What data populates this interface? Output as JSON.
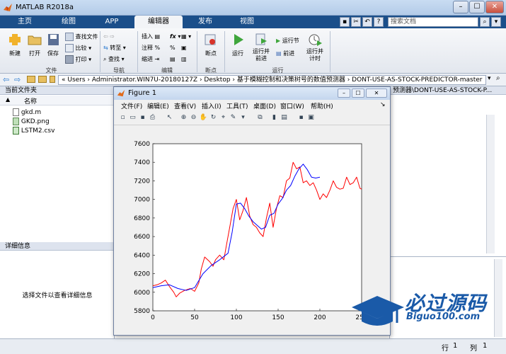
{
  "window": {
    "title": "MATLAB R2018a",
    "controls": [
      "–",
      "☐",
      "✕"
    ]
  },
  "ribbon_tabs": [
    "主页",
    "绘图",
    "APP",
    "编辑器",
    "发布",
    "视图"
  ],
  "active_tab": "编辑器",
  "search": {
    "placeholder": "搜索文档"
  },
  "ribbon": {
    "groups": {
      "file": "文件",
      "navigate": "导航",
      "edit": "编辑",
      "breakpoints": "断点",
      "run": "运行"
    },
    "file": {
      "new": "新建",
      "open": "打开",
      "save": "保存",
      "find_files": "查找文件",
      "compare": "比较",
      "print": "打印"
    },
    "navigate": {
      "goto": "转至",
      "find": "查找"
    },
    "edit": {
      "insert": "插入",
      "comment": "注释",
      "indent": "缩进"
    },
    "breakpoints": {
      "breakpoints": "断点"
    },
    "run": {
      "run": "运行",
      "run_advance": "运行并\n前进",
      "run_section": "运行节",
      "advance": "前进",
      "run_time": "运行并\n计时"
    }
  },
  "address": {
    "path": "«  Users  ›  Administrator.WIN7U-20180127Z  ›  Desktop  ›  基于模糊控制和决策树号的数值预测器  ›  DONT-USE-AS-STOCK-PREDICTOR-master"
  },
  "file_panel": {
    "header": "当前文件夹",
    "column": "名称",
    "sort_arrow": "▲",
    "files": [
      "gkd.m",
      "GKD.png",
      "LSTM2.csv"
    ]
  },
  "detail_panel": {
    "header": "详细信息",
    "message": "选择文件以查看详细信息"
  },
  "right_panel": {
    "path_fragment": "预测器\\DONT-USE-AS-STOCK-P..."
  },
  "status": {
    "row_label": "行",
    "row": "1",
    "col_label": "列",
    "col": "1"
  },
  "figure": {
    "title": "Figure 1",
    "menu": [
      "文件(F)",
      "编辑(E)",
      "查看(V)",
      "插入(I)",
      "工具(T)",
      "桌面(D)",
      "窗口(W)",
      "帮助(H)"
    ]
  },
  "watermark": {
    "text": "必过源码",
    "url": "Biguo100.com"
  },
  "colors": {
    "actual_series": "#ff0000",
    "predicted_series": "#0000ff",
    "tab_bar": "#1b4f8a"
  },
  "chart_data": {
    "type": "line",
    "xlim": [
      0,
      250
    ],
    "ylim": [
      5800,
      7600
    ],
    "xticks": [
      0,
      50,
      100,
      150,
      200,
      250
    ],
    "yticks": [
      5800,
      6000,
      6200,
      6400,
      6600,
      6800,
      7000,
      7200,
      7400,
      7600
    ],
    "series": [
      {
        "color": "red",
        "x": [
          0,
          5,
          10,
          15,
          20,
          25,
          28,
          32,
          38,
          45,
          50,
          55,
          58,
          62,
          68,
          72,
          75,
          80,
          85,
          88,
          92,
          96,
          100,
          104,
          108,
          112,
          116,
          120,
          124,
          128,
          132,
          136,
          140,
          144,
          148,
          152,
          156,
          160,
          164,
          168,
          172,
          176,
          180,
          184,
          188,
          192,
          196,
          200,
          204,
          208,
          212,
          216,
          220,
          224,
          228,
          232,
          236,
          240,
          244,
          248,
          250
        ],
        "values": [
          6070,
          6080,
          6100,
          6130,
          6060,
          6000,
          5950,
          5990,
          6020,
          6040,
          6010,
          6100,
          6250,
          6380,
          6330,
          6280,
          6350,
          6400,
          6350,
          6500,
          6700,
          6900,
          7000,
          6780,
          6880,
          7020,
          6820,
          6730,
          6700,
          6640,
          6600,
          6800,
          6960,
          6700,
          6900,
          7040,
          7020,
          7200,
          7230,
          7400,
          7330,
          7350,
          7180,
          7200,
          7150,
          7180,
          7100,
          7000,
          7060,
          7020,
          7100,
          7200,
          7130,
          7110,
          7120,
          7240,
          7160,
          7180,
          7240,
          7120,
          7110
        ]
      },
      {
        "color": "blue",
        "x": [
          0,
          10,
          20,
          30,
          40,
          50,
          60,
          70,
          80,
          90,
          95,
          100,
          105,
          110,
          115,
          120,
          125,
          130,
          135,
          140,
          145,
          150,
          155,
          160,
          165,
          170,
          175,
          180,
          185,
          190,
          195,
          200
        ],
        "values": [
          6050,
          6070,
          6080,
          6040,
          6020,
          6050,
          6200,
          6290,
          6350,
          6420,
          6650,
          6950,
          6960,
          6900,
          6820,
          6760,
          6720,
          6680,
          6700,
          6830,
          6850,
          6950,
          7010,
          7100,
          7150,
          7250,
          7330,
          7380,
          7320,
          7240,
          7230,
          7240
        ]
      }
    ]
  }
}
